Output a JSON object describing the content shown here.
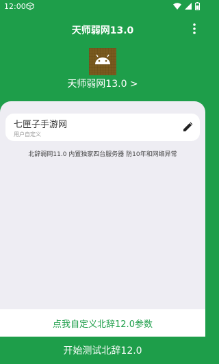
{
  "status_bar": {
    "time": "12:00",
    "icons": [
      "box-icon",
      "wifi-icon",
      "signal-icon",
      "battery-icon"
    ]
  },
  "app_bar": {
    "title": "天师弱网13.0",
    "menu_icon": "more-vert-icon"
  },
  "header": {
    "logo_icon": "android-icon",
    "app_name": "天师弱网13.0 >"
  },
  "entry": {
    "name": "七匣子手游网",
    "subtitle": "用户自定义",
    "edit_icon": "pencil-icon"
  },
  "note": "北辞弱网11.0 内置独家四台服务器 防10年和网络异常",
  "buttons": {
    "custom": "点我自定义北辞12.0参数",
    "start": "开始测试北辞12.0"
  },
  "colors": {
    "primary": "#1e9e4a",
    "panel": "#eeedf3",
    "logo_bg": "#7a5a1e"
  }
}
